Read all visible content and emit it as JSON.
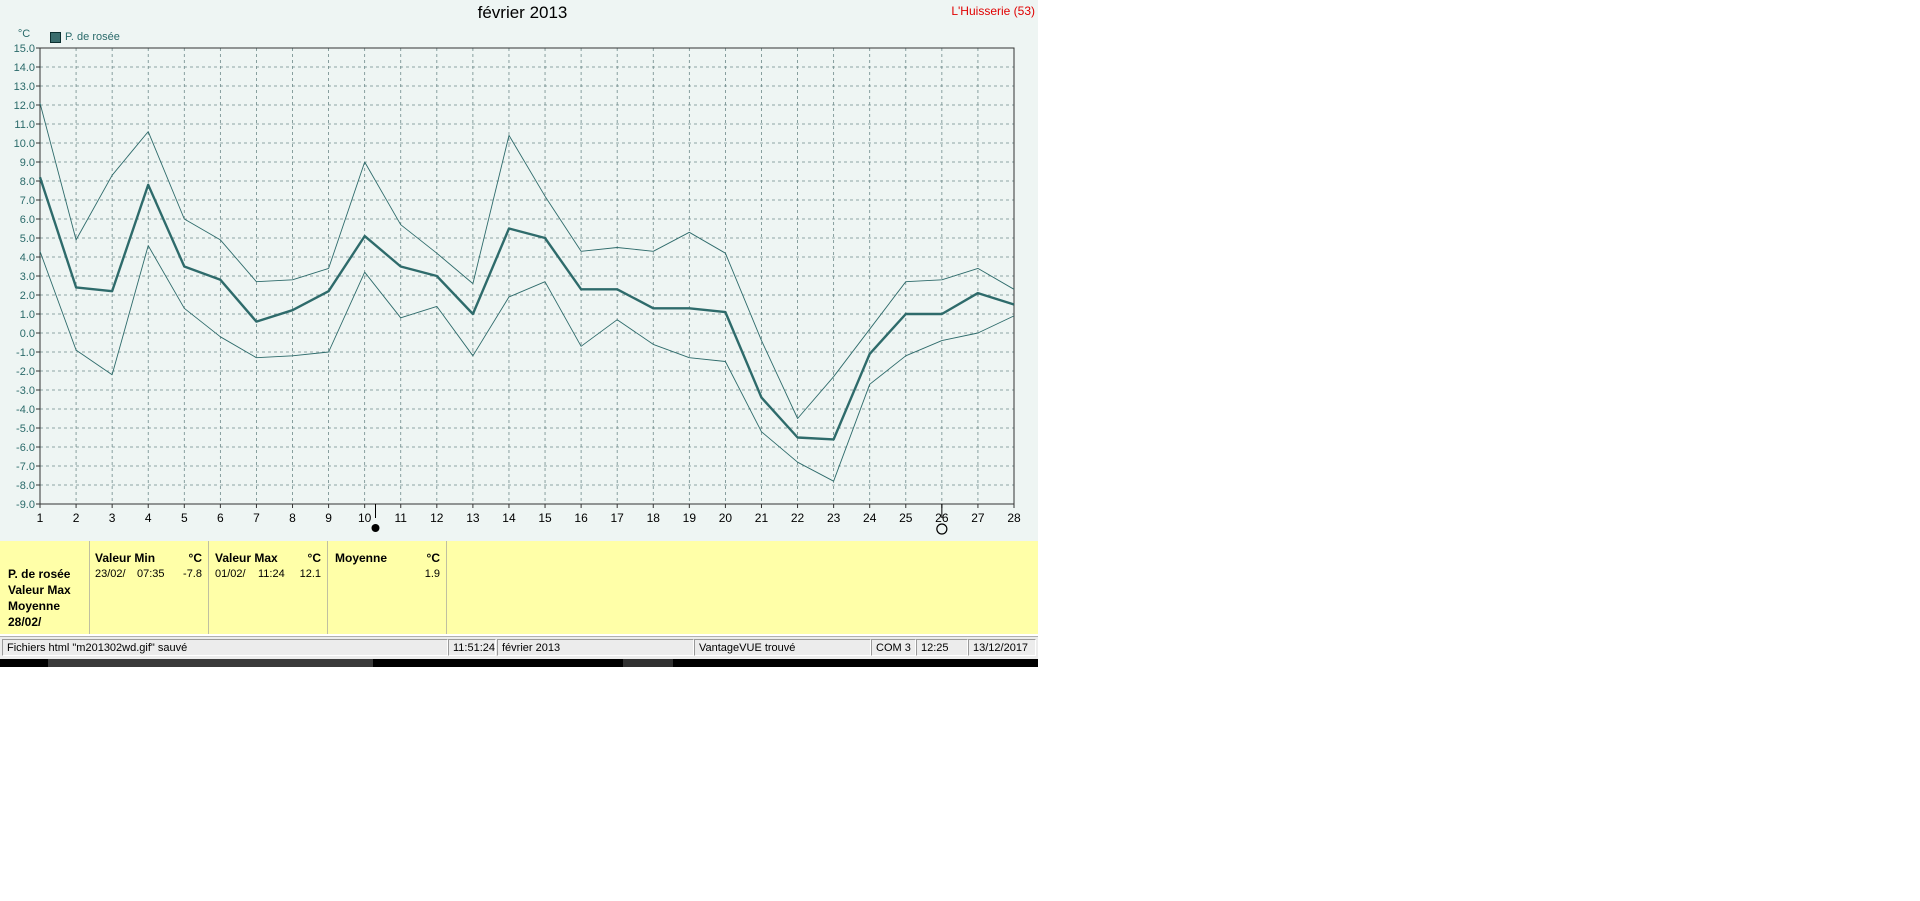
{
  "window": {
    "station_label": "L'Huisserie (53)"
  },
  "colors": {
    "series": "#2e6b6b",
    "background": "#eef5f3",
    "panel": "#ffffa8",
    "station": "#e00000"
  },
  "chart_data": {
    "type": "line",
    "title": "février 2013",
    "ylabel": "°C",
    "xlabel": "",
    "ylim": [
      -9,
      15
    ],
    "ytick_step": 1,
    "yticks": [
      "15.0",
      "14.0",
      "13.0",
      "12.0",
      "11.0",
      "10.0",
      "9.0",
      "8.0",
      "7.0",
      "6.0",
      "5.0",
      "4.0",
      "3.0",
      "2.0",
      "1.0",
      "0.0",
      "-1.0",
      "-2.0",
      "-3.0",
      "-4.0",
      "-5.0",
      "-6.0",
      "-7.0",
      "-8.0",
      "-9.0"
    ],
    "x": [
      1,
      2,
      3,
      4,
      5,
      6,
      7,
      8,
      9,
      10,
      11,
      12,
      13,
      14,
      15,
      16,
      17,
      18,
      19,
      20,
      21,
      22,
      23,
      24,
      25,
      26,
      27,
      28
    ],
    "grid": true,
    "legend": {
      "label": "P. de rosée",
      "placement": "top-left"
    },
    "series": [
      {
        "name": "P. de rosée",
        "role": "mean",
        "values": [
          8.2,
          2.4,
          2.2,
          7.8,
          3.5,
          2.8,
          0.6,
          1.2,
          2.2,
          5.1,
          3.5,
          3.0,
          1.0,
          5.5,
          5.0,
          2.3,
          2.3,
          1.3,
          1.3,
          1.1,
          -3.4,
          -5.5,
          -5.6,
          -1.1,
          1.0,
          1.0,
          2.1,
          1.5
        ]
      },
      {
        "role": "max",
        "values": [
          12.1,
          4.9,
          8.3,
          10.6,
          6.0,
          4.9,
          2.7,
          2.8,
          3.4,
          9.0,
          5.7,
          4.2,
          2.6,
          10.4,
          7.2,
          4.3,
          4.5,
          4.3,
          5.3,
          4.2,
          -0.4,
          -4.5,
          -2.3,
          0.2,
          2.7,
          2.8,
          3.4,
          2.3
        ]
      },
      {
        "role": "min",
        "values": [
          4.3,
          -0.9,
          -2.2,
          4.6,
          1.3,
          -0.2,
          -1.3,
          -1.2,
          -1.0,
          3.2,
          0.8,
          1.4,
          -1.2,
          1.9,
          2.7,
          -0.7,
          0.7,
          -0.6,
          -1.3,
          -1.5,
          -5.2,
          -6.8,
          -7.8,
          -2.7,
          -1.2,
          -0.4,
          0.0,
          0.9
        ]
      }
    ]
  },
  "panel": {
    "rows": [
      "P. de rosée",
      "Valeur Max",
      "Moyenne",
      "28/02/"
    ],
    "min": {
      "header": "Valeur Min",
      "unit": "°C",
      "date": "23/02/",
      "time": "07:35",
      "value": "-7.8"
    },
    "max": {
      "header": "Valeur Max",
      "unit": "°C",
      "date": "01/02/",
      "time": "11:24",
      "value": "12.1"
    },
    "avg": {
      "header": "Moyenne",
      "unit": "°C",
      "value": "1.9"
    }
  },
  "statusbar": {
    "message": "Fichiers html  \"m201302wd.gif\"  sauvé",
    "time": "11:51:24",
    "period": "février 2013",
    "station": "VantageVUE trouvé",
    "port": "COM 3",
    "clock": "12:25",
    "date": "13/12/2017"
  }
}
